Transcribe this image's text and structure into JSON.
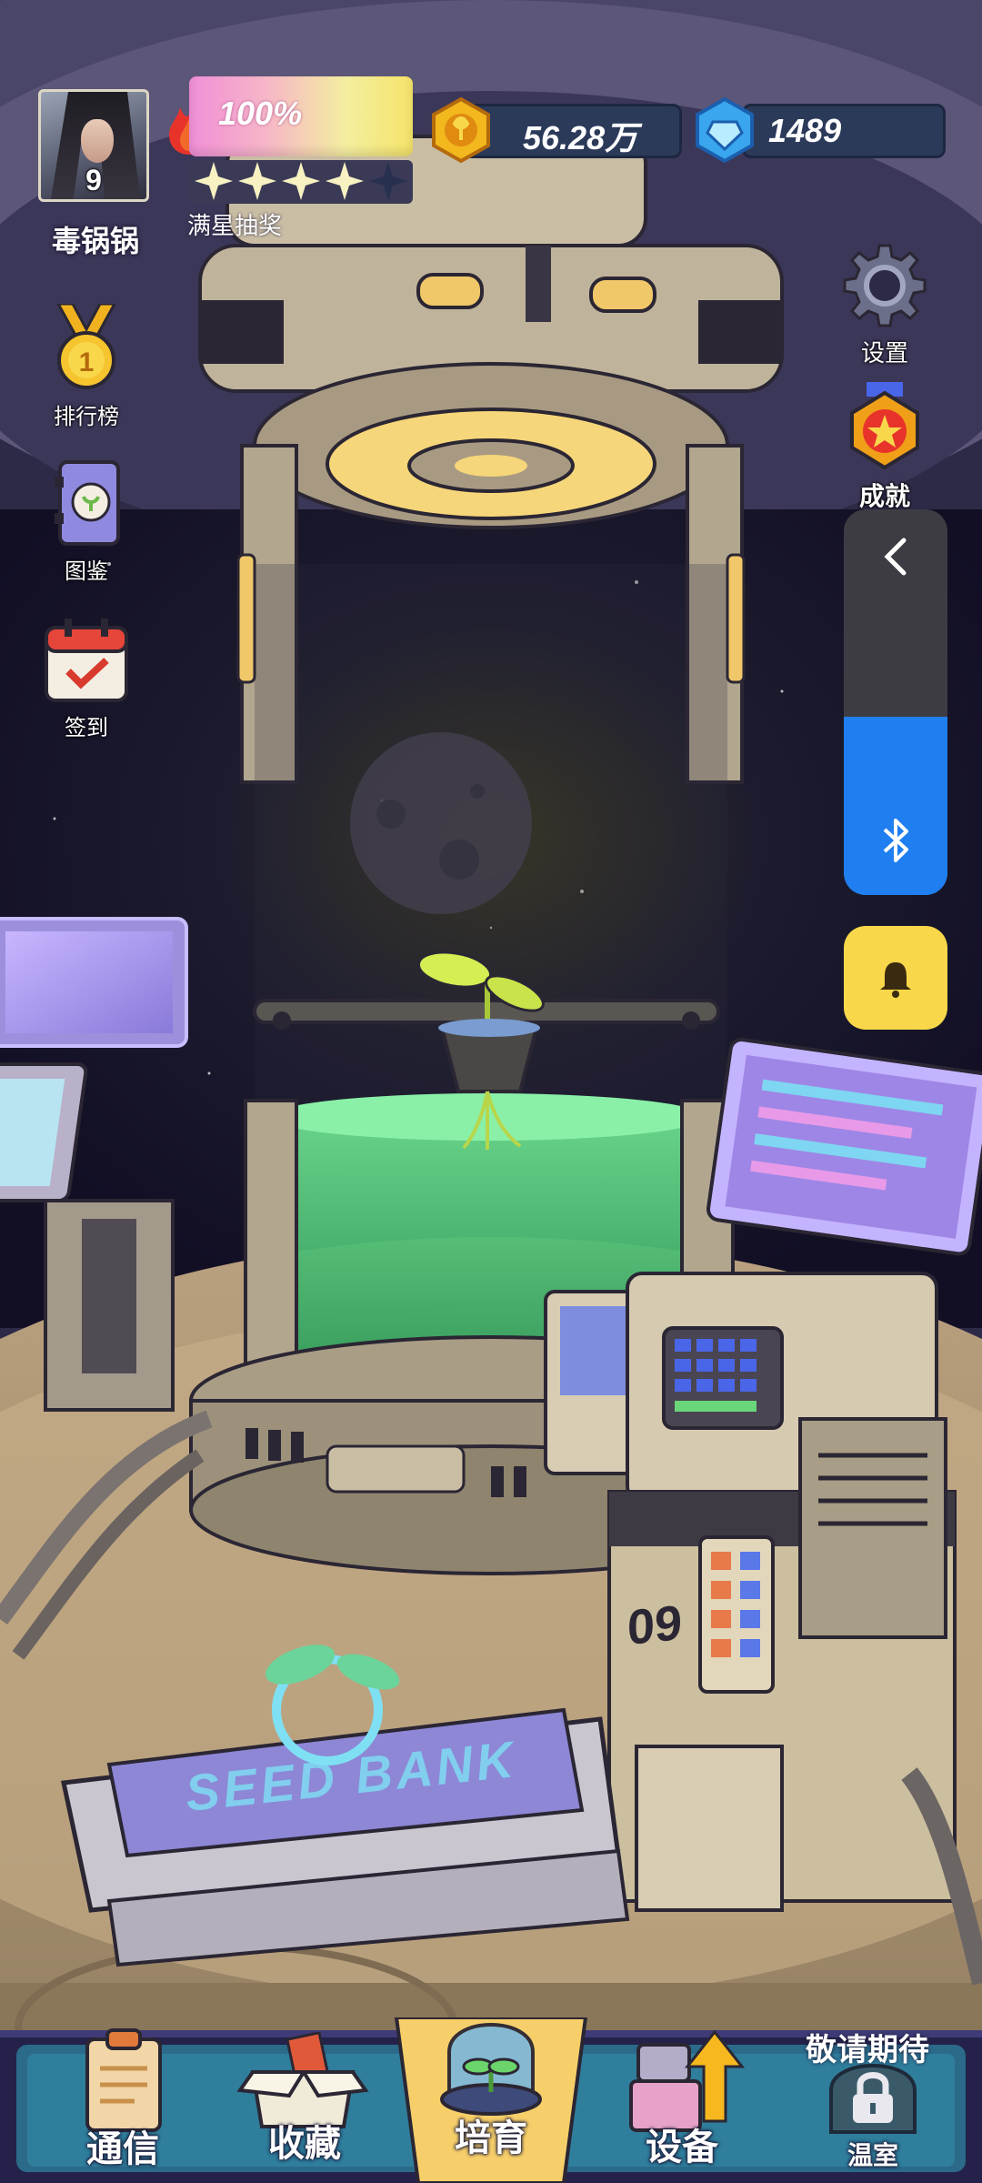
{
  "player": {
    "level": "9",
    "name": "毒锅锅"
  },
  "energy": {
    "percent_text": "100%",
    "percent": 100,
    "stars_filled": 4,
    "stars_total": 5,
    "lottery_label": "满星抽奖"
  },
  "currency": {
    "coins": "56.28万",
    "gems": "1489"
  },
  "left_menu": [
    {
      "id": "leaderboard",
      "label": "排行榜",
      "icon": "medal-icon"
    },
    {
      "id": "catalog",
      "label": "图鉴",
      "icon": "book-icon"
    },
    {
      "id": "checkin",
      "label": "签到",
      "icon": "calendar-check-icon"
    }
  ],
  "right_menu": [
    {
      "id": "settings",
      "label": "设置",
      "icon": "gear-icon"
    },
    {
      "id": "achievements",
      "label": "成就",
      "icon": "badge-icon"
    }
  ],
  "machine": {
    "unit_number": "09",
    "bank_sign": "SEED BANK"
  },
  "bottom_nav": [
    {
      "id": "comms",
      "label": "通信",
      "icon": "clipboard-icon"
    },
    {
      "id": "collection",
      "label": "收藏",
      "icon": "box-icon"
    },
    {
      "id": "cultivate",
      "label": "培育",
      "icon": "sprout-dome-icon",
      "active": true
    },
    {
      "id": "equipment",
      "label": "设备",
      "icon": "upgrade-arrow-icon"
    },
    {
      "id": "greenhouse",
      "label": "温室",
      "icon": "lock-icon",
      "locked": true,
      "note": "敬请期待"
    }
  ],
  "colors": {
    "accent_yellow": "#f8d84a",
    "system_blue": "#1f7ff0",
    "nav_active": "#f6cf6a",
    "tank_green": "#4fce7f"
  }
}
